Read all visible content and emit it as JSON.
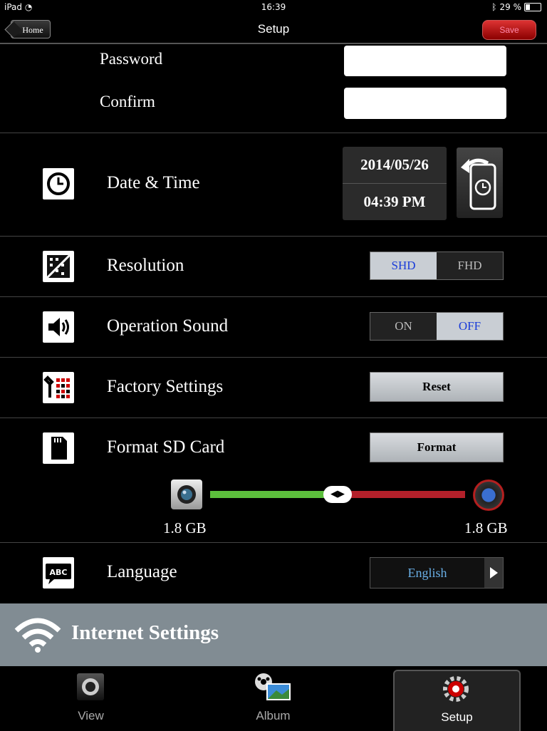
{
  "status": {
    "device": "iPad",
    "time": "16:39",
    "battery": "29 %"
  },
  "nav": {
    "title": "Setup",
    "home_label": "Home",
    "save_label": "Save"
  },
  "password": {
    "label": "Password",
    "value": "",
    "confirm_label": "Confirm",
    "confirm_value": ""
  },
  "datetime": {
    "label": "Date & Time",
    "date": "2014/05/26",
    "time": "04:39 PM"
  },
  "resolution": {
    "label": "Resolution",
    "options": [
      "SHD",
      "FHD"
    ],
    "selected": "SHD"
  },
  "sound": {
    "label": "Operation Sound",
    "options": [
      "ON",
      "OFF"
    ],
    "selected": "OFF"
  },
  "factory": {
    "label": "Factory Settings",
    "button": "Reset"
  },
  "sdcard": {
    "label": "Format SD Card",
    "button": "Format",
    "camera_storage": "1.8 GB",
    "device_storage": "1.8 GB",
    "slider_position": 0.5
  },
  "language": {
    "label": "Language",
    "value": "English"
  },
  "internet": {
    "title": "Internet Settings"
  },
  "tabs": {
    "view": "View",
    "album": "Album",
    "setup": "Setup"
  },
  "colors": {
    "slider_left": "#5cbf3c",
    "slider_right": "#b3202a",
    "save": "#c0161e",
    "segment_active_text": "#1a3cd9"
  }
}
